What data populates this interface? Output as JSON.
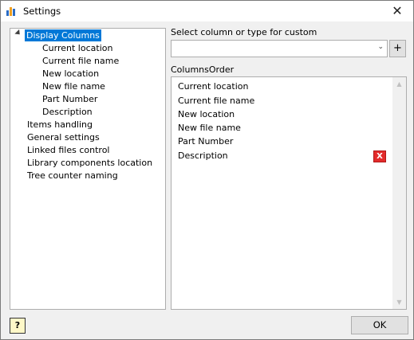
{
  "window": {
    "title": "Settings",
    "close_glyph": "✕",
    "app_icon": "app-icon"
  },
  "tree": {
    "root": {
      "label": "Display Columns",
      "expanded": true,
      "children": [
        "Current location",
        "Current file name",
        "New location",
        "New file name",
        "Part Number",
        "Description"
      ]
    },
    "others": [
      "Items handling",
      "General settings",
      "Linked files control",
      "Library components location",
      "Tree counter naming"
    ]
  },
  "select_label": "Select column or type for custom",
  "combo": {
    "value": "",
    "arrow": "⌄"
  },
  "add_button": "+",
  "columns_order_label": "ColumnsOrder",
  "columns_order": [
    "Current location",
    "Current file name",
    "New location",
    "New file name",
    "Part Number",
    "Description"
  ],
  "delete_glyph": "X",
  "ok_button": "OK",
  "help_button": "?",
  "colors": {
    "selection": "#0078d7",
    "delete": "#e32b2b",
    "help_bg": "#fff8c8"
  }
}
